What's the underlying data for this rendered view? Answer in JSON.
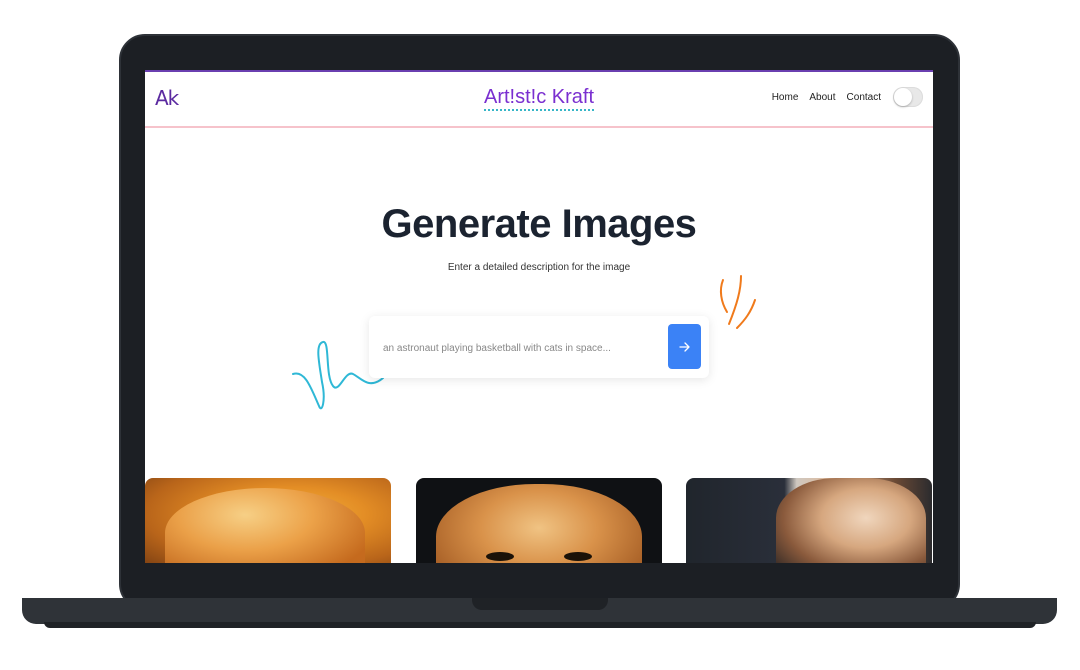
{
  "navbar": {
    "logo": "Ak",
    "brand": "Art!st!c Kraft",
    "links": [
      "Home",
      "About",
      "Contact"
    ]
  },
  "hero": {
    "title": "Generate Images",
    "subtitle": "Enter a detailed description for the image"
  },
  "search": {
    "placeholder": "an astronaut playing basketball with cats in space...",
    "submit_icon": "arrow-right-icon"
  },
  "colors": {
    "accent": "#3b82f6",
    "brand": "#7a2fd0",
    "nav_border": "#f6c3cb",
    "doodle_blue": "#2fb8d6",
    "doodle_orange": "#f07a1b"
  },
  "gallery": {
    "items": [
      "orange-cat-image",
      "ginger-cat-image",
      "calico-cat-image"
    ]
  }
}
